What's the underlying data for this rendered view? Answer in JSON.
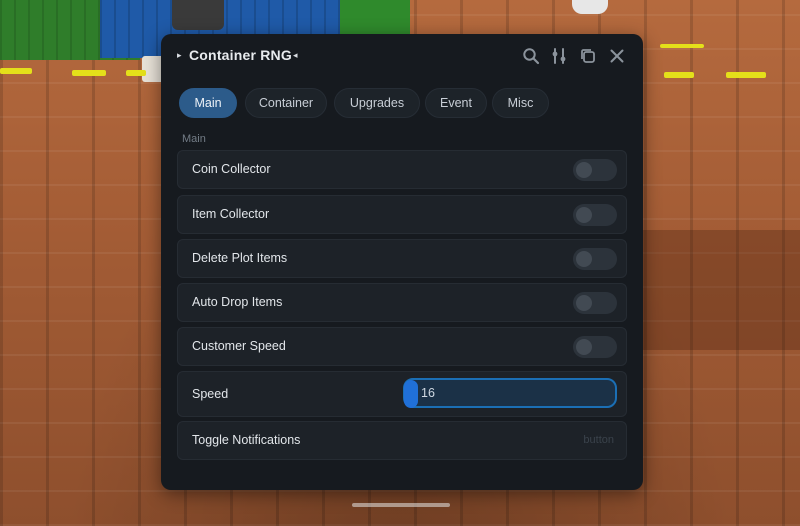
{
  "window": {
    "title": "Container RNG",
    "title_left_glyph": "▸",
    "title_right_glyph": "◂",
    "icons": [
      "search-icon",
      "tune-icon",
      "copy-icon",
      "close-icon"
    ]
  },
  "tabs": [
    {
      "label": "Main",
      "active": true
    },
    {
      "label": "Container",
      "active": false
    },
    {
      "label": "Upgrades",
      "active": false
    },
    {
      "label": "Event",
      "active": false
    },
    {
      "label": "Misc",
      "active": false
    }
  ],
  "section": {
    "label": "Main"
  },
  "rows": [
    {
      "label": "Coin Collector",
      "type": "toggle",
      "value": false
    },
    {
      "label": "Item Collector",
      "type": "toggle",
      "value": false
    },
    {
      "label": "Delete Plot Items",
      "type": "toggle",
      "value": false
    },
    {
      "label": "Auto Drop Items",
      "type": "toggle",
      "value": false
    },
    {
      "label": "Customer Speed",
      "type": "toggle",
      "value": false
    },
    {
      "label": "Speed",
      "type": "input",
      "value": "16"
    },
    {
      "label": "Toggle Notifications",
      "type": "button",
      "button_label": "button"
    }
  ],
  "colors": {
    "window_bg": "#161a1f",
    "row_bg": "#1d2228",
    "tab_active": "#2c5b8a",
    "input_border": "#1b6fb5"
  }
}
